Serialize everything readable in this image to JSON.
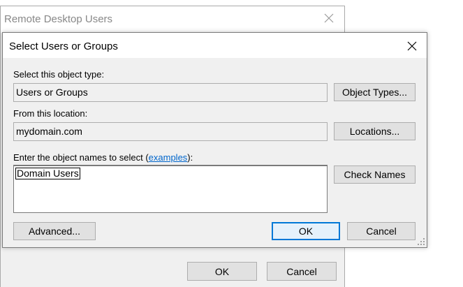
{
  "background_dialog": {
    "title": "Remote Desktop Users",
    "ok_label": "OK",
    "cancel_label": "Cancel"
  },
  "dialog": {
    "title": "Select Users or Groups",
    "object_type": {
      "label": "Select this object type:",
      "value": "Users or Groups",
      "button_label": "Object Types..."
    },
    "location": {
      "label": "From this location:",
      "value": "mydomain.com",
      "button_label": "Locations..."
    },
    "names": {
      "label_prefix": "Enter the object names to select (",
      "label_link": "examples",
      "label_suffix": "):",
      "value": "Domain Users",
      "button_label": "Check Names"
    },
    "advanced_label": "Advanced...",
    "ok_label": "OK",
    "cancel_label": "Cancel"
  },
  "colors": {
    "dialog_bg": "#f0f0f0",
    "button_bg": "#e1e1e1",
    "default_button_border": "#0078d7",
    "link": "#0066cc"
  }
}
